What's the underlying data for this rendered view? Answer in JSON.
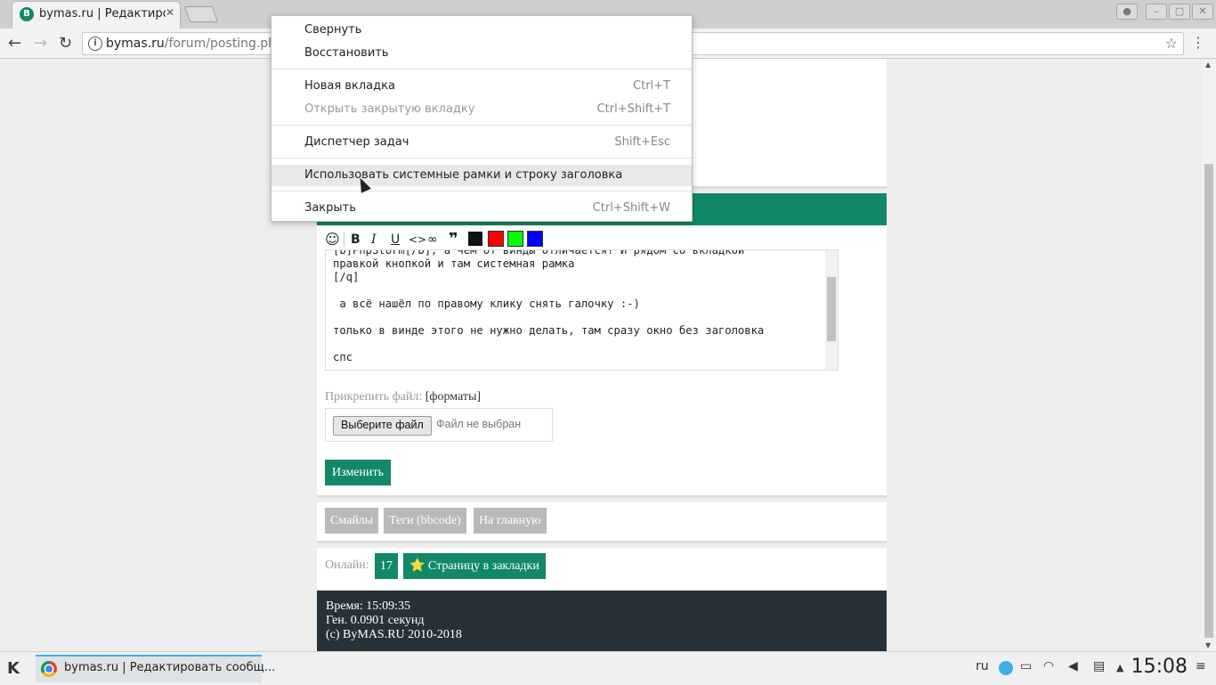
{
  "browser": {
    "tab_title": "bymas.ru | Редактиро",
    "tab_favicon_letter": "B",
    "url_host": "bymas.ru",
    "url_path": "/forum/posting.ph"
  },
  "menu": {
    "items": [
      {
        "label": "Свернуть",
        "shortcut": ""
      },
      {
        "label": "Восстановить",
        "shortcut": ""
      },
      {
        "label": "Новая вкладка",
        "shortcut": "Ctrl+T"
      },
      {
        "label": "Открыть закрытую вкладку",
        "shortcut": "Ctrl+Shift+T",
        "disabled": true
      },
      {
        "label": "Диспетчер задач",
        "shortcut": "Shift+Esc"
      },
      {
        "label": "Использовать системные рамки и строку заголовка",
        "shortcut": "",
        "highlighted": true
      },
      {
        "label": "Закрыть",
        "shortcut": "Ctrl+Shift+W"
      }
    ]
  },
  "editor": {
    "text": "[b]PhpStorm[/b], а чем от винды отличается? И рядом со вкладкой\nправкой кнопкой и там системная рамка\n[/q]\n\n а всё нашёл по правому клику снять галочку :-)\n\nтолько в винде этого не нужно делать, там сразу окно без заголовка\n\nспс",
    "colors": [
      "#ff0000",
      "#00ff00",
      "#0000ff"
    ],
    "attach_label": "Прикрепить файл:",
    "attach_formats": "[форматы]",
    "file_button": "Выберите файл",
    "file_status": "Файл не выбран",
    "submit_label": "Изменить"
  },
  "links": {
    "smiles": "Смайлы",
    "tags": "Теги (bbcode)",
    "home": "На главную"
  },
  "online": {
    "label": "Онлайн:",
    "count": "17",
    "bookmark": "⭐ Страницу в закладки"
  },
  "footer": {
    "time": "Время: 15:09:35",
    "gen": "Ген. 0.0901 секунд",
    "copyright": "(c) ByMAS.RU 2010-2018"
  },
  "taskbar": {
    "task_title": "bymas.ru | Редактировать сообщ...",
    "lang": "ru",
    "clock": "15:08"
  }
}
